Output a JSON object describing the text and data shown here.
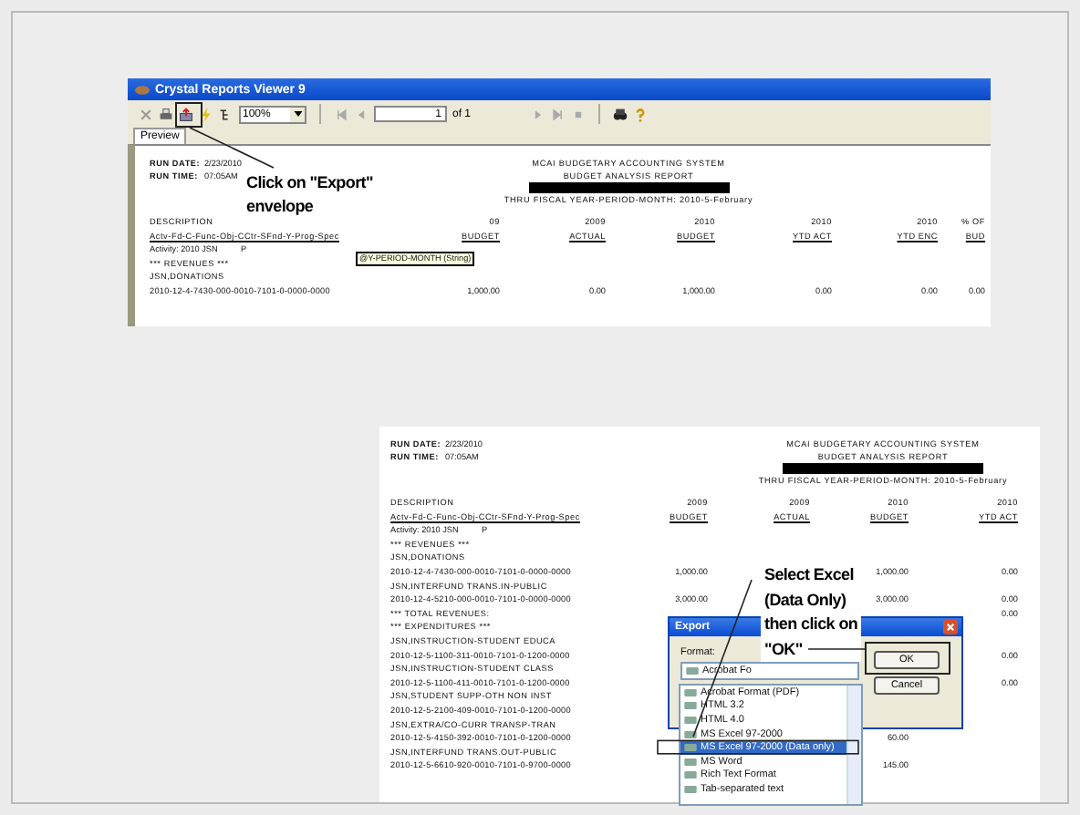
{
  "viewer": {
    "title": "Crystal Reports Viewer 9",
    "zoom": "100%",
    "page": "1",
    "page_of": "of 1",
    "tabs": [
      {
        "label": "Preview",
        "selected": true
      }
    ],
    "report": {
      "run_date_label": "RUN DATE:",
      "run_date": "2/23/2010",
      "run_time_label": "RUN TIME:",
      "run_time": "07:05AM",
      "title_lines": [
        "MCAI BUDGETARY ACCOUNTING SYSTEM",
        "BUDGET ANALYSIS REPORT"
      ],
      "period": "THRU FISCAL YEAR-PERIOD-MONTH: 2010-5-February",
      "tooltip": "@Y-PERIOD-MONTH (String)",
      "desc_label": "DESCRIPTION",
      "desc_code": "Actv-Fd-C-Func-Obj-CCtr-SFnd-Y-Prog-Spec",
      "columns": [
        {
          "year": "09",
          "label": "BUDGET"
        },
        {
          "year": "2009",
          "label": "ACTUAL"
        },
        {
          "year": "2010",
          "label": "BUDGET"
        },
        {
          "year": "2010",
          "label": "YTD ACT"
        },
        {
          "year": "2010",
          "label": "YTD ENC"
        },
        {
          "year": "% OF",
          "label": "BUD"
        }
      ],
      "rows": [
        {
          "text": "Activity: 2010 JSN          P",
          "kind": "activity",
          "values": []
        },
        {
          "text": "*** REVENUES ***",
          "kind": "heading",
          "values": []
        },
        {
          "text": "JSN,DONATIONS",
          "kind": "heading",
          "values": []
        },
        {
          "text": "2010-12-4-7430-000-0010-7101-0-0000-0000",
          "kind": "account",
          "values": [
            "1,000.00",
            "0.00",
            "1,000.00",
            "0.00",
            "0.00",
            "0.00"
          ]
        }
      ]
    }
  },
  "report2": {
    "run_date_label": "RUN DATE:",
    "run_date": "2/23/2010",
    "run_time_label": "RUN TIME:",
    "run_time": "07:05AM",
    "title_lines": [
      "MCAI BUDGETARY ACCOUNTING SYSTEM",
      "BUDGET ANALYSIS REPORT"
    ],
    "period": "THRU FISCAL YEAR-PERIOD-MONTH: 2010-5-February",
    "desc_label": "DESCRIPTION",
    "desc_code": "Actv-Fd-C-Func-Obj-CCtr-SFnd-Y-Prog-Spec",
    "columns": [
      {
        "year": "2009",
        "label": "BUDGET"
      },
      {
        "year": "2009",
        "label": "ACTUAL"
      },
      {
        "year": "2010",
        "label": "BUDGET"
      },
      {
        "year": "2010",
        "label": "YTD ACT"
      }
    ],
    "rows": [
      {
        "text": "Activity: 2010 JSN          P",
        "kind": "activity"
      },
      {
        "text": "*** REVENUES ***",
        "kind": "heading"
      },
      {
        "text": "JSN,DONATIONS",
        "kind": "heading"
      },
      {
        "text": "2010-12-4-7430-000-0010-7101-0-0000-0000",
        "kind": "account",
        "budget_2009": "1,000.00",
        "budget_2010": "1,000.00",
        "ytd_act_2010": "0.00"
      },
      {
        "text": "JSN,INTERFUND TRANS.IN-PUBLIC",
        "kind": "heading"
      },
      {
        "text": "2010-12-4-5210-000-0010-7101-0-0000-0000",
        "kind": "account",
        "budget_2009": "3,000.00",
        "budget_2010": "3,000.00",
        "ytd_act_2010": "0.00"
      },
      {
        "text": "*** TOTAL REVENUES:",
        "kind": "total",
        "ytd_act_2010": "0.00"
      },
      {
        "text": "*** EXPENDITURES ***",
        "kind": "heading"
      },
      {
        "text": "JSN,INSTRUCTION-STUDENT EDUCA",
        "kind": "heading"
      },
      {
        "text": "2010-12-5-1100-311-0010-7101-0-1200-0000",
        "kind": "account",
        "ytd_act_2010": "0.00"
      },
      {
        "text": "JSN,INSTRUCTION-STUDENT CLASS",
        "kind": "heading"
      },
      {
        "text": "2010-12-5-1100-411-0010-7101-0-1200-0000",
        "kind": "account",
        "ytd_act_2010": "0.00"
      },
      {
        "text": "JSN,STUDENT SUPP-OTH NON INST",
        "kind": "heading"
      },
      {
        "text": "2010-12-5-2100-409-0010-7101-0-1200-0000",
        "kind": "account"
      },
      {
        "text": "JSN,EXTRA/CO-CURR TRANSP-TRAN",
        "kind": "heading"
      },
      {
        "text": "2010-12-5-4150-392-0010-7101-0-1200-0000",
        "kind": "account",
        "budget_2010": "60.00"
      },
      {
        "text": "JSN,INTERFUND TRANS.OUT-PUBLIC",
        "kind": "heading"
      },
      {
        "text": "2010-12-5-6610-920-0010-7101-0-9700-0000",
        "kind": "account",
        "budget_2010": "145.00"
      }
    ]
  },
  "export_dialog": {
    "title": "Export",
    "format_label": "Format:",
    "format_value": "Acrobat Fo",
    "buttons": [
      "OK",
      "Cancel"
    ],
    "options": [
      {
        "label": "Acrobat Format (PDF)",
        "selected": false
      },
      {
        "label": "HTML 3.2",
        "selected": false
      },
      {
        "label": "HTML 4.0",
        "selected": false
      },
      {
        "label": "MS Excel 97-2000",
        "selected": false
      },
      {
        "label": "MS Excel 97-2000 (Data only)",
        "selected": true
      },
      {
        "label": "MS Word",
        "selected": false
      },
      {
        "label": "Rich Text Format",
        "selected": false
      },
      {
        "label": "Tab-separated text",
        "selected": false
      }
    ]
  },
  "annotations": [
    {
      "lines": [
        "Click on \"Export\"",
        "envelope"
      ]
    },
    {
      "lines": [
        "Select Excel",
        "(Data Only)",
        "then click on",
        "\"OK\""
      ]
    }
  ]
}
